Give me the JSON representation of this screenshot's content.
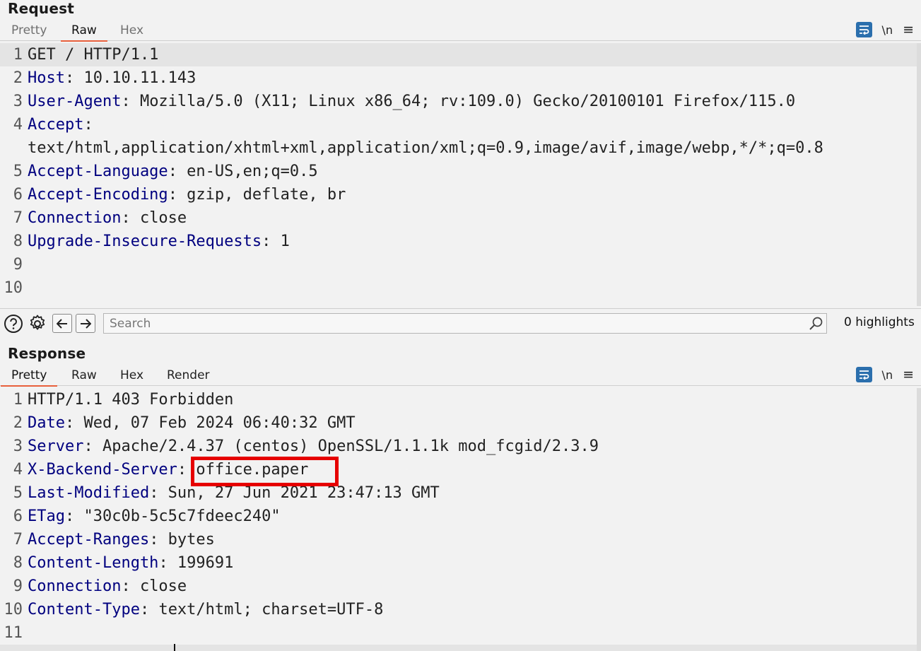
{
  "request": {
    "title": "Request",
    "tabs": [
      {
        "label": "Pretty",
        "active": false
      },
      {
        "label": "Raw",
        "active": true
      },
      {
        "label": "Hex",
        "active": false
      }
    ],
    "tools": {
      "newline_label": "\\n",
      "menu_label": "≡"
    },
    "lines": [
      {
        "n": "1",
        "key": "",
        "text": "GET / HTTP/1.1"
      },
      {
        "n": "2",
        "key": "Host",
        "text": ": 10.10.11.143"
      },
      {
        "n": "3",
        "key": "User-Agent",
        "text": ": Mozilla/5.0 (X11; Linux x86_64; rv:109.0) Gecko/20100101 Firefox/115.0"
      },
      {
        "n": "4",
        "key": "Accept",
        "text": ":"
      },
      {
        "n": "",
        "key": "",
        "text": "text/html,application/xhtml+xml,application/xml;q=0.9,image/avif,image/webp,*/*;q=0.8"
      },
      {
        "n": "5",
        "key": "Accept-Language",
        "text": ": en-US,en;q=0.5"
      },
      {
        "n": "6",
        "key": "Accept-Encoding",
        "text": ": gzip, deflate, br"
      },
      {
        "n": "7",
        "key": "Connection",
        "text": ": close"
      },
      {
        "n": "8",
        "key": "Upgrade-Insecure-Requests",
        "text": ": 1"
      },
      {
        "n": "9",
        "key": "",
        "text": ""
      },
      {
        "n": "10",
        "key": "",
        "text": ""
      }
    ]
  },
  "search": {
    "placeholder": "Search",
    "highlights_label": "0 highlights"
  },
  "response": {
    "title": "Response",
    "tabs": [
      {
        "label": "Pretty",
        "active": true
      },
      {
        "label": "Raw",
        "active": false
      },
      {
        "label": "Hex",
        "active": false
      },
      {
        "label": "Render",
        "active": false
      }
    ],
    "tools": {
      "newline_label": "\\n",
      "menu_label": "≡"
    },
    "lines": [
      {
        "n": "1",
        "key": "",
        "text": "HTTP/1.1 403 Forbidden"
      },
      {
        "n": "2",
        "key": "Date",
        "text": ": Wed, 07 Feb 2024 06:40:32 GMT"
      },
      {
        "n": "3",
        "key": "Server",
        "text": ": Apache/2.4.37 (centos) OpenSSL/1.1.1k mod_fcgid/2.3.9"
      },
      {
        "n": "4",
        "key": "X-Backend-Server",
        "text": ": office.paper"
      },
      {
        "n": "5",
        "key": "Last-Modified",
        "text": ": Sun, 27 Jun 2021 23:47:13 GMT"
      },
      {
        "n": "6",
        "key": "ETag",
        "text": ": \"30c0b-5c5c7fdeec240\""
      },
      {
        "n": "7",
        "key": "Accept-Ranges",
        "text": ": bytes"
      },
      {
        "n": "8",
        "key": "Content-Length",
        "text": ": 199691"
      },
      {
        "n": "9",
        "key": "Connection",
        "text": ": close"
      },
      {
        "n": "10",
        "key": "Content-Type",
        "text": ": text/html; charset=UTF-8"
      },
      {
        "n": "11",
        "key": "",
        "text": ""
      }
    ]
  },
  "colors": {
    "accent_tab": "#e8603c",
    "header_key": "#00007f",
    "annotation_box": "#e60000",
    "wrap_button": "#2b6fad"
  }
}
